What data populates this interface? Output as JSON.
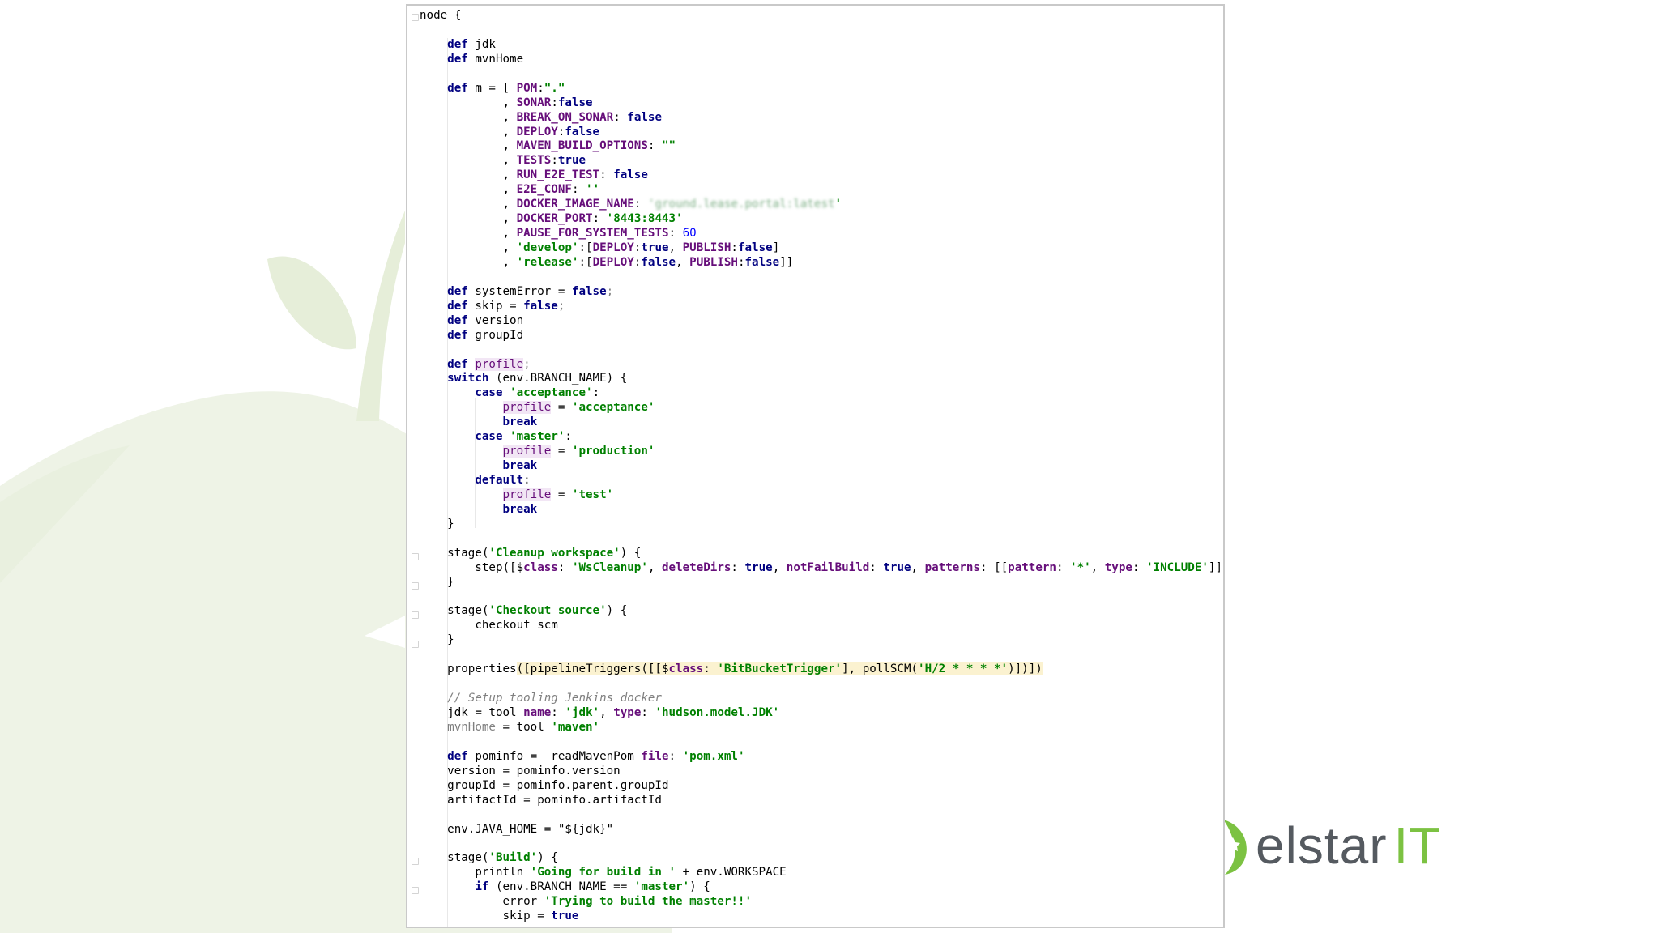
{
  "code": {
    "lines": [
      [
        [
          "t",
          "node {"
        ]
      ],
      [],
      [
        [
          "t",
          "    "
        ],
        [
          "kw",
          "def"
        ],
        [
          "t",
          " jdk"
        ]
      ],
      [
        [
          "t",
          "    "
        ],
        [
          "kw",
          "def"
        ],
        [
          "t",
          " mvnHome"
        ]
      ],
      [],
      [
        [
          "t",
          "    "
        ],
        [
          "kw",
          "def"
        ],
        [
          "t",
          " m = [ "
        ],
        [
          "f",
          "POM"
        ],
        [
          "t",
          ":"
        ],
        [
          "s",
          "\".\""
        ]
      ],
      [
        [
          "t",
          "            , "
        ],
        [
          "f",
          "SONAR"
        ],
        [
          "t",
          ":"
        ],
        [
          "kw",
          "false"
        ]
      ],
      [
        [
          "t",
          "            , "
        ],
        [
          "f",
          "BREAK_ON_SONAR"
        ],
        [
          "t",
          ": "
        ],
        [
          "kw",
          "false"
        ]
      ],
      [
        [
          "t",
          "            , "
        ],
        [
          "f",
          "DEPLOY"
        ],
        [
          "t",
          ":"
        ],
        [
          "kw",
          "false"
        ]
      ],
      [
        [
          "t",
          "            , "
        ],
        [
          "f",
          "MAVEN_BUILD_OPTIONS"
        ],
        [
          "t",
          ": "
        ],
        [
          "s",
          "\"\""
        ]
      ],
      [
        [
          "t",
          "            , "
        ],
        [
          "f",
          "TESTS"
        ],
        [
          "t",
          ":"
        ],
        [
          "kw",
          "true"
        ]
      ],
      [
        [
          "t",
          "            , "
        ],
        [
          "f",
          "RUN_E2E_TEST"
        ],
        [
          "t",
          ": "
        ],
        [
          "kw",
          "false"
        ]
      ],
      [
        [
          "t",
          "            , "
        ],
        [
          "f",
          "E2E_CONF"
        ],
        [
          "t",
          ": "
        ],
        [
          "s",
          "''"
        ]
      ],
      [
        [
          "t",
          "            , "
        ],
        [
          "f",
          "DOCKER_IMAGE_NAME"
        ],
        [
          "t",
          ": "
        ],
        [
          "blur",
          "'ground.lease.portal:latest"
        ],
        [
          "s",
          "'"
        ]
      ],
      [
        [
          "t",
          "            , "
        ],
        [
          "f",
          "DOCKER_PORT"
        ],
        [
          "t",
          ": "
        ],
        [
          "s",
          "'8443:8443'"
        ]
      ],
      [
        [
          "t",
          "            , "
        ],
        [
          "f",
          "PAUSE_FOR_SYSTEM_TESTS"
        ],
        [
          "t",
          ": "
        ],
        [
          "n",
          "60"
        ]
      ],
      [
        [
          "t",
          "            , "
        ],
        [
          "s",
          "'develop'"
        ],
        [
          "t",
          ":["
        ],
        [
          "f",
          "DEPLOY"
        ],
        [
          "t",
          ":"
        ],
        [
          "kw",
          "true"
        ],
        [
          "t",
          ", "
        ],
        [
          "f",
          "PUBLISH"
        ],
        [
          "t",
          ":"
        ],
        [
          "kw",
          "false"
        ],
        [
          "t",
          "]"
        ]
      ],
      [
        [
          "t",
          "            , "
        ],
        [
          "s",
          "'release'"
        ],
        [
          "t",
          ":["
        ],
        [
          "f",
          "DEPLOY"
        ],
        [
          "t",
          ":"
        ],
        [
          "kw",
          "false"
        ],
        [
          "t",
          ", "
        ],
        [
          "f",
          "PUBLISH"
        ],
        [
          "t",
          ":"
        ],
        [
          "kw",
          "false"
        ],
        [
          "t",
          "]]"
        ]
      ],
      [],
      [
        [
          "t",
          "    "
        ],
        [
          "kw",
          "def"
        ],
        [
          "t",
          " systemError = "
        ],
        [
          "kw",
          "false"
        ],
        [
          "gr",
          ";"
        ]
      ],
      [
        [
          "t",
          "    "
        ],
        [
          "kw",
          "def"
        ],
        [
          "t",
          " skip = "
        ],
        [
          "kw",
          "false"
        ],
        [
          "gr",
          ";"
        ]
      ],
      [
        [
          "t",
          "    "
        ],
        [
          "kw",
          "def"
        ],
        [
          "t",
          " version"
        ]
      ],
      [
        [
          "t",
          "    "
        ],
        [
          "kw",
          "def"
        ],
        [
          "t",
          " groupId"
        ]
      ],
      [],
      [
        [
          "t",
          "    "
        ],
        [
          "kw",
          "def"
        ],
        [
          "t",
          " "
        ],
        [
          "lv",
          "profile"
        ],
        [
          "gr",
          ";"
        ]
      ],
      [
        [
          "t",
          "    "
        ],
        [
          "kw",
          "switch"
        ],
        [
          "t",
          " (env.BRANCH_NAME) {"
        ]
      ],
      [
        [
          "t",
          "        "
        ],
        [
          "kw",
          "case"
        ],
        [
          "t",
          " "
        ],
        [
          "s",
          "'acceptance'"
        ],
        [
          "t",
          ":"
        ]
      ],
      [
        [
          "t",
          "            "
        ],
        [
          "lv",
          "profile"
        ],
        [
          "t",
          " = "
        ],
        [
          "s",
          "'acceptance'"
        ]
      ],
      [
        [
          "t",
          "            "
        ],
        [
          "kw",
          "break"
        ]
      ],
      [
        [
          "t",
          "        "
        ],
        [
          "kw",
          "case"
        ],
        [
          "t",
          " "
        ],
        [
          "s",
          "'master'"
        ],
        [
          "t",
          ":"
        ]
      ],
      [
        [
          "t",
          "            "
        ],
        [
          "lv",
          "profile"
        ],
        [
          "t",
          " = "
        ],
        [
          "s",
          "'production'"
        ]
      ],
      [
        [
          "t",
          "            "
        ],
        [
          "kw",
          "break"
        ]
      ],
      [
        [
          "t",
          "        "
        ],
        [
          "kw",
          "default"
        ],
        [
          "t",
          ":"
        ]
      ],
      [
        [
          "t",
          "            "
        ],
        [
          "lv",
          "profile"
        ],
        [
          "t",
          " = "
        ],
        [
          "s",
          "'test'"
        ]
      ],
      [
        [
          "t",
          "            "
        ],
        [
          "kw",
          "break"
        ]
      ],
      [
        [
          "t",
          "    }"
        ]
      ],
      [],
      [
        [
          "t",
          "    stage("
        ],
        [
          "s",
          "'Cleanup workspace'"
        ],
        [
          "t",
          ") {"
        ]
      ],
      [
        [
          "t",
          "        step([$"
        ],
        [
          "f",
          "class"
        ],
        [
          "t",
          ": "
        ],
        [
          "s",
          "'WsCleanup'"
        ],
        [
          "t",
          ", "
        ],
        [
          "f",
          "deleteDirs"
        ],
        [
          "t",
          ": "
        ],
        [
          "kw",
          "true"
        ],
        [
          "t",
          ", "
        ],
        [
          "f",
          "notFailBuild"
        ],
        [
          "t",
          ": "
        ],
        [
          "kw",
          "true"
        ],
        [
          "t",
          ", "
        ],
        [
          "f",
          "patterns"
        ],
        [
          "t",
          ": [["
        ],
        [
          "f",
          "pattern"
        ],
        [
          "t",
          ": "
        ],
        [
          "s",
          "'*'"
        ],
        [
          "t",
          ", "
        ],
        [
          "f",
          "type"
        ],
        [
          "t",
          ": "
        ],
        [
          "s",
          "'INCLUDE'"
        ],
        [
          "t",
          "]]])"
        ]
      ],
      [
        [
          "t",
          "    }"
        ]
      ],
      [],
      [
        [
          "t",
          "    stage("
        ],
        [
          "s",
          "'Checkout source'"
        ],
        [
          "t",
          ") {"
        ]
      ],
      [
        [
          "t",
          "        checkout scm"
        ]
      ],
      [
        [
          "t",
          "    }"
        ]
      ],
      [],
      [
        [
          "t",
          "    properties"
        ],
        [
          "hlw",
          "([pipelineTriggers([[$"
        ],
        [
          "hlwf",
          "class"
        ],
        [
          "hlw",
          ": "
        ],
        [
          "hlws",
          "'BitBucketTrigger'"
        ],
        [
          "hlw",
          "], pollSCM("
        ],
        [
          "hlws",
          "'H/2 * * * *'"
        ],
        [
          "hlw",
          ")])])"
        ]
      ],
      [],
      [
        [
          "t",
          "    "
        ],
        [
          "c",
          "// Setup tooling Jenkins docker"
        ]
      ],
      [
        [
          "t",
          "    jdk = tool "
        ],
        [
          "f",
          "name"
        ],
        [
          "t",
          ": "
        ],
        [
          "s",
          "'jdk'"
        ],
        [
          "t",
          ", "
        ],
        [
          "f",
          "type"
        ],
        [
          "t",
          ": "
        ],
        [
          "s",
          "'hudson.model.JDK'"
        ]
      ],
      [
        [
          "t",
          "    "
        ],
        [
          "gr",
          "mvnHome"
        ],
        [
          "t",
          " = tool "
        ],
        [
          "s",
          "'maven'"
        ]
      ],
      [],
      [
        [
          "t",
          "    "
        ],
        [
          "kw",
          "def"
        ],
        [
          "t",
          " pominfo =  readMavenPom "
        ],
        [
          "f",
          "file"
        ],
        [
          "t",
          ": "
        ],
        [
          "s",
          "'pom.xml'"
        ]
      ],
      [
        [
          "t",
          "    version = pominfo.version"
        ]
      ],
      [
        [
          "t",
          "    groupId = pominfo.parent.groupId"
        ]
      ],
      [
        [
          "t",
          "    artifactId = pominfo.artifactId"
        ]
      ],
      [],
      [
        [
          "t",
          "    env.JAVA_HOME = "
        ],
        [
          "t",
          "\"${jdk}\""
        ]
      ],
      [],
      [
        [
          "t",
          "    stage("
        ],
        [
          "s",
          "'Build'"
        ],
        [
          "t",
          ") {"
        ]
      ],
      [
        [
          "t",
          "        println "
        ],
        [
          "s",
          "'Going for build in '"
        ],
        [
          "t",
          " + env.WORKSPACE"
        ]
      ],
      [
        [
          "t",
          "        "
        ],
        [
          "kw",
          "if"
        ],
        [
          "t",
          " (env.BRANCH_NAME == "
        ],
        [
          "s",
          "'master'"
        ],
        [
          "t",
          ") {"
        ]
      ],
      [
        [
          "t",
          "            error "
        ],
        [
          "s",
          "'Trying to build the master!!'"
        ]
      ],
      [
        [
          "t",
          "            skip = "
        ],
        [
          "kw",
          "true"
        ]
      ]
    ]
  },
  "logo": {
    "word": "elstar",
    "accent": "IT",
    "colors": {
      "word": "#555a60",
      "accent": "#7cc242"
    }
  },
  "colors": {
    "keyword": "#000080",
    "string": "#008000",
    "number": "#0000ff",
    "field": "#660e7a",
    "comment": "#808080",
    "apple": "#eef3e6"
  }
}
